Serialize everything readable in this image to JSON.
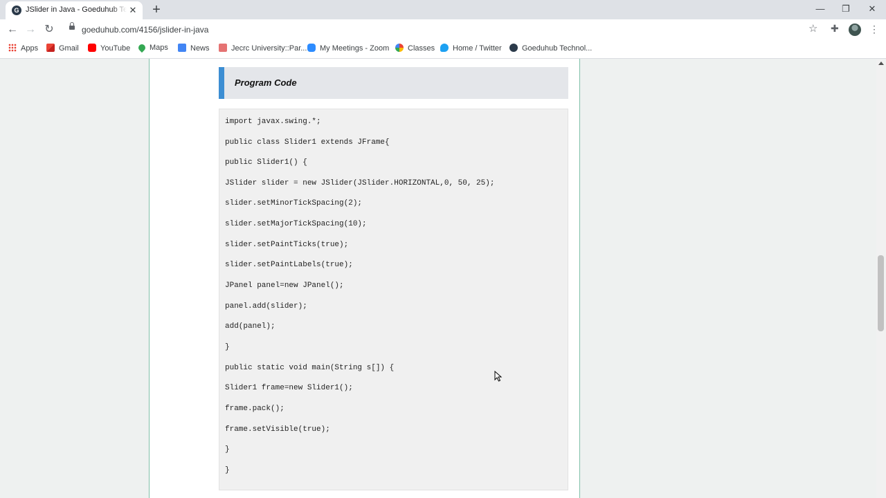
{
  "browser": {
    "tab_title": "JSlider in Java - Goeduhub Techn",
    "tab_favicon_letter": "G",
    "url": "goeduhub.com/4156/jslider-in-java",
    "window_controls": [
      "minimize",
      "restore",
      "close"
    ],
    "bookmarks": [
      {
        "label": "Apps",
        "icon": "apps-grid-icon"
      },
      {
        "label": "Gmail",
        "icon": "gmail-icon"
      },
      {
        "label": "YouTube",
        "icon": "youtube-icon"
      },
      {
        "label": "Maps",
        "icon": "maps-pin-icon"
      },
      {
        "label": "News",
        "icon": "news-icon"
      },
      {
        "label": "Jecrc University::Par...",
        "icon": "jecrc-icon"
      },
      {
        "label": "My Meetings - Zoom",
        "icon": "zoom-icon"
      },
      {
        "label": "Classes",
        "icon": "google-icon"
      },
      {
        "label": "Home / Twitter",
        "icon": "twitter-icon"
      },
      {
        "label": "Goeduhub Technol...",
        "icon": "goeduhub-icon"
      }
    ]
  },
  "article": {
    "section_title": "Program Code",
    "code_lines": [
      "import javax.swing.*;",
      "public class Slider1 extends JFrame{",
      "public Slider1() {",
      "JSlider slider = new JSlider(JSlider.HORIZONTAL,0, 50, 25);",
      "slider.setMinorTickSpacing(2);",
      "slider.setMajorTickSpacing(10);",
      "slider.setPaintTicks(true);",
      "slider.setPaintLabels(true);",
      "JPanel panel=new JPanel();",
      "panel.add(slider);",
      "add(panel);",
      "}",
      "public static void main(String s[]) {",
      "Slider1 frame=new Slider1();",
      "frame.pack();",
      "frame.setVisible(true);",
      "}",
      "}"
    ]
  },
  "colors": {
    "accent_bar": "#3c8ed3",
    "column_border": "#7fbfa8",
    "page_bg": "#eef1f0"
  }
}
